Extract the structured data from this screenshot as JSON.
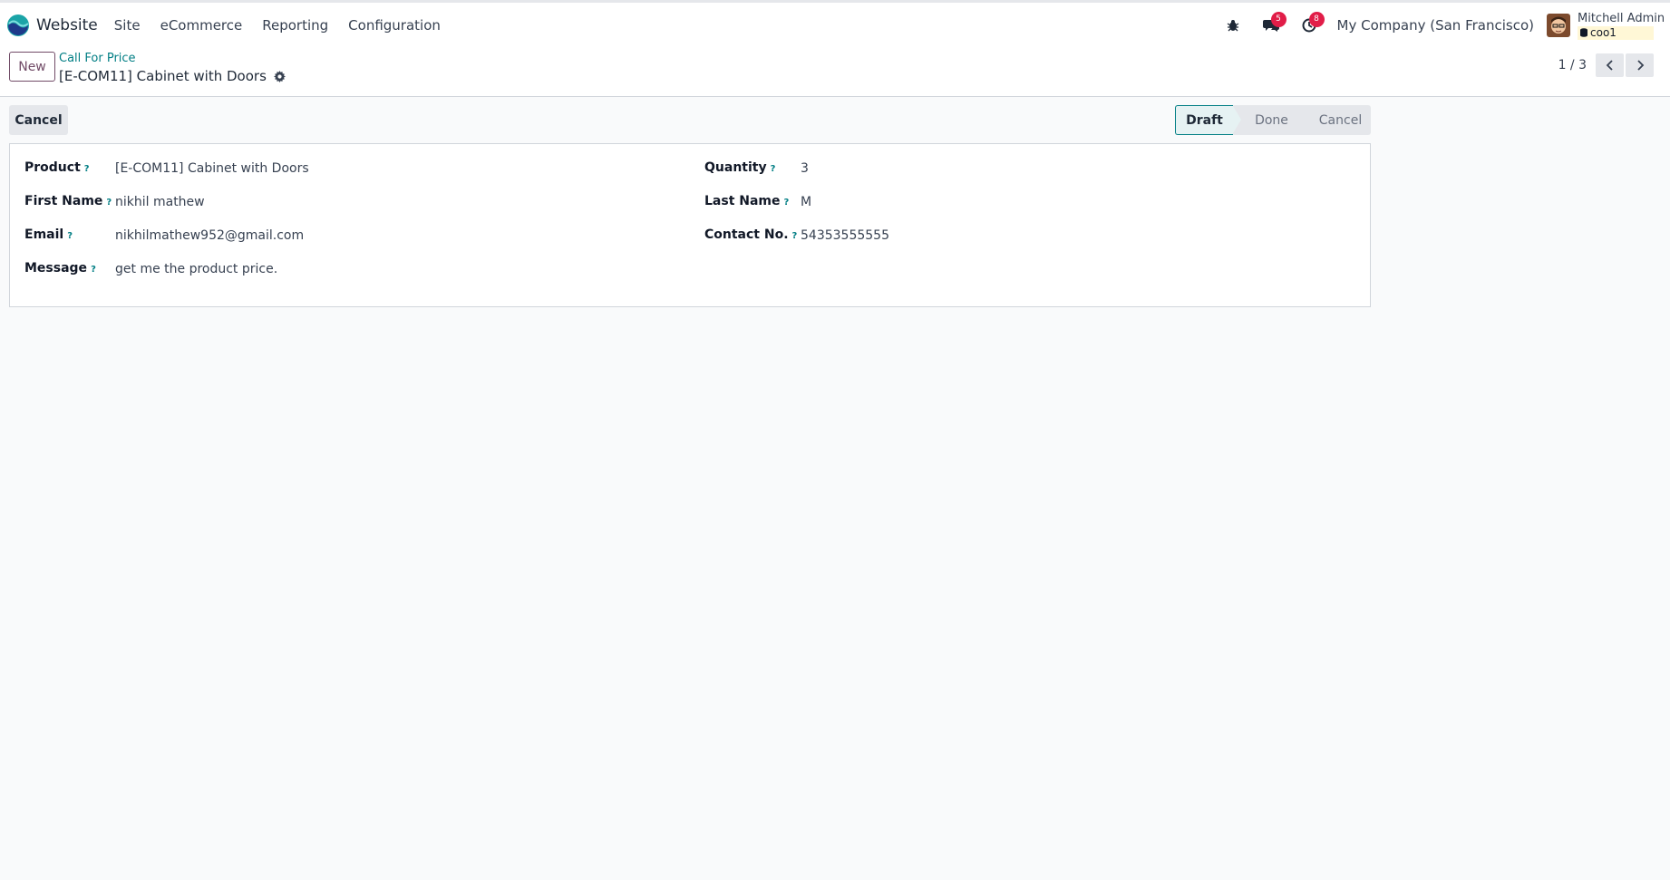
{
  "navbar": {
    "app_name": "Website",
    "menu": [
      "Site",
      "eCommerce",
      "Reporting",
      "Configuration"
    ],
    "messages_count": "5",
    "activities_count": "8",
    "company": "My Company (San Francisco)",
    "user_name": "Mitchell Admin",
    "database": "coo1"
  },
  "control_panel": {
    "new_label": "New",
    "breadcrumb_parent": "Call For Price",
    "breadcrumb_current": "[E-COM11] Cabinet with Doors",
    "pager": "1 / 3"
  },
  "statusbar": {
    "cancel_label": "Cancel",
    "stages": [
      "Draft",
      "Done",
      "Cancel"
    ],
    "active_stage": "Draft"
  },
  "form": {
    "left": [
      {
        "label": "Product",
        "value": "[E-COM11] Cabinet with Doors"
      },
      {
        "label": "First Name",
        "value": "nikhil mathew"
      },
      {
        "label": "Email",
        "value": "nikhilmathew952@gmail.com"
      },
      {
        "label": "Message",
        "value": "get me the product price."
      }
    ],
    "right": [
      {
        "label": "Quantity",
        "value": "3"
      },
      {
        "label": "Last Name",
        "value": "M"
      },
      {
        "label": "Contact No.",
        "value": "54353555555"
      }
    ],
    "help_mark": "?"
  },
  "colors": {
    "brand": "#714b67",
    "accent": "#017e84",
    "badge": "#e11d48"
  }
}
